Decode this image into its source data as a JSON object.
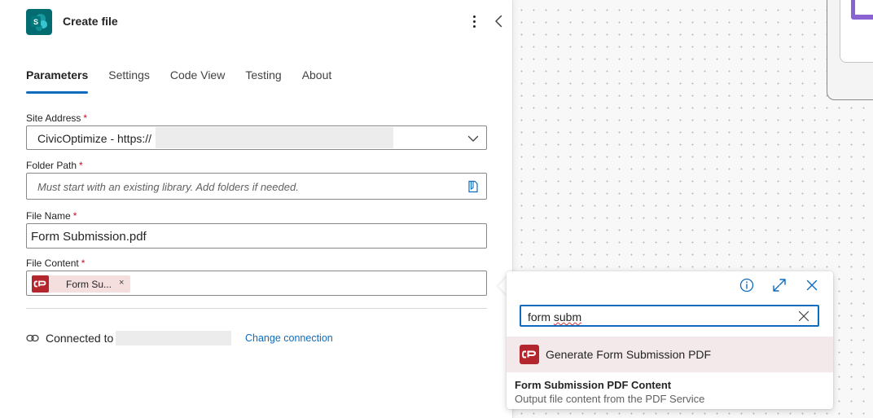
{
  "header": {
    "title": "Create file",
    "app_icon": "sharepoint-icon"
  },
  "tabs": [
    {
      "label": "Parameters",
      "active": true
    },
    {
      "label": "Settings",
      "active": false
    },
    {
      "label": "Code View",
      "active": false
    },
    {
      "label": "Testing",
      "active": false
    },
    {
      "label": "About",
      "active": false
    }
  ],
  "fields": {
    "site_address": {
      "label": "Site Address",
      "required_mark": "*",
      "value": "CivicOptimize - https://"
    },
    "folder_path": {
      "label": "Folder Path",
      "required_mark": "*",
      "placeholder": "Must start with an existing library. Add folders if needed."
    },
    "file_name": {
      "label": "File Name",
      "required_mark": "*",
      "value": "Form Submission.pdf"
    },
    "file_content": {
      "label": "File Content",
      "required_mark": "*",
      "token_label": "Form Su...",
      "token_remove": "×"
    }
  },
  "connection": {
    "label": "Connected to",
    "change_link": "Change connection"
  },
  "popup": {
    "search_prefix": "form ",
    "search_underlined": "subm",
    "item_label": "Generate Form Submission PDF",
    "section_title": "Form Submission PDF Content",
    "section_desc": "Output file content from the PDF Service"
  },
  "colors": {
    "accent": "#0f6cbd",
    "required": "#c50f1f",
    "connector_brand": "#b3262d",
    "sharepoint_brand": "#036c70"
  }
}
